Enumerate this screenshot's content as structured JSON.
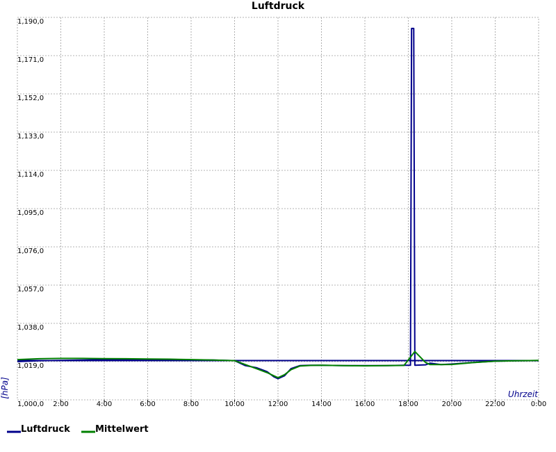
{
  "chart_data": {
    "type": "line",
    "title": "Luftdruck",
    "xlabel": "Uhrzeit",
    "ylabel": "[hPa]",
    "xlim": [
      0,
      24
    ],
    "ylim": [
      1000,
      1190
    ],
    "x_tick_labels": [
      "2:00",
      "4:00",
      "6:00",
      "8:00",
      "10:00",
      "12:00",
      "14:00",
      "16:00",
      "18:00",
      "20:00",
      "22:00",
      "0:00"
    ],
    "x_tick_values": [
      2,
      4,
      6,
      8,
      10,
      12,
      14,
      16,
      18,
      20,
      22,
      24
    ],
    "y_tick_labels": [
      "1,000,0",
      "1,019,0",
      "1,038,0",
      "1,057,0",
      "1,076,0",
      "1,095,0",
      "1,114,0",
      "1,133,0",
      "1,152,0",
      "1,171,0",
      "1,190,0"
    ],
    "y_tick_values": [
      1000,
      1019,
      1038,
      1057,
      1076,
      1095,
      1114,
      1133,
      1152,
      1171,
      1190
    ],
    "grid": true,
    "legend_position": "bottom-left",
    "reference_line": {
      "value": 1019.5,
      "color": "#00008b"
    },
    "series": [
      {
        "name": "Luftdruck",
        "color": "#00008b",
        "x": [
          0,
          1,
          2,
          3,
          4,
          5,
          6,
          7,
          8,
          9,
          10,
          10.5,
          11,
          11.5,
          11.8,
          12,
          12.3,
          12.6,
          13,
          13.5,
          14,
          15,
          16,
          17,
          17.8,
          18.1,
          18.15,
          18.25,
          18.3,
          18.8,
          19,
          19.5,
          20,
          21,
          22,
          23,
          24
        ],
        "y": [
          1019,
          1019.4,
          1019.6,
          1019.8,
          1019.9,
          1019.9,
          1019.8,
          1019.7,
          1019.7,
          1019.8,
          1019.5,
          1017,
          1016,
          1014,
          1011.5,
          1010.5,
          1012,
          1015.5,
          1017,
          1017.2,
          1017.2,
          1017.0,
          1017.0,
          1017.0,
          1017.2,
          1017.2,
          1184.5,
          1184.5,
          1017.2,
          1017.4,
          1018.2,
          1017.5,
          1017.8,
          1018.6,
          1019.2,
          1019.4,
          1019.5
        ]
      },
      {
        "name": "Mittelwert",
        "color": "#008000",
        "x": [
          0,
          1,
          2,
          3,
          4,
          5,
          6,
          7,
          8,
          9,
          10,
          10.5,
          11,
          11.5,
          11.8,
          12,
          12.3,
          12.6,
          13,
          13.5,
          14,
          15,
          16,
          17,
          17.8,
          18.3,
          18.8,
          19,
          20,
          21,
          22,
          23,
          24
        ],
        "y": [
          1020,
          1020.4,
          1020.6,
          1020.6,
          1020.5,
          1020.4,
          1020.3,
          1020.2,
          1020.0,
          1019.8,
          1019.5,
          1017.5,
          1015.5,
          1013.5,
          1012,
          1011,
          1012.5,
          1015,
          1016.8,
          1017.1,
          1017.2,
          1017.0,
          1016.9,
          1017.0,
          1017.1,
          1024,
          1018.5,
          1017.5,
          1017.6,
          1018.5,
          1019.2,
          1019.4,
          1019.6
        ]
      }
    ]
  }
}
